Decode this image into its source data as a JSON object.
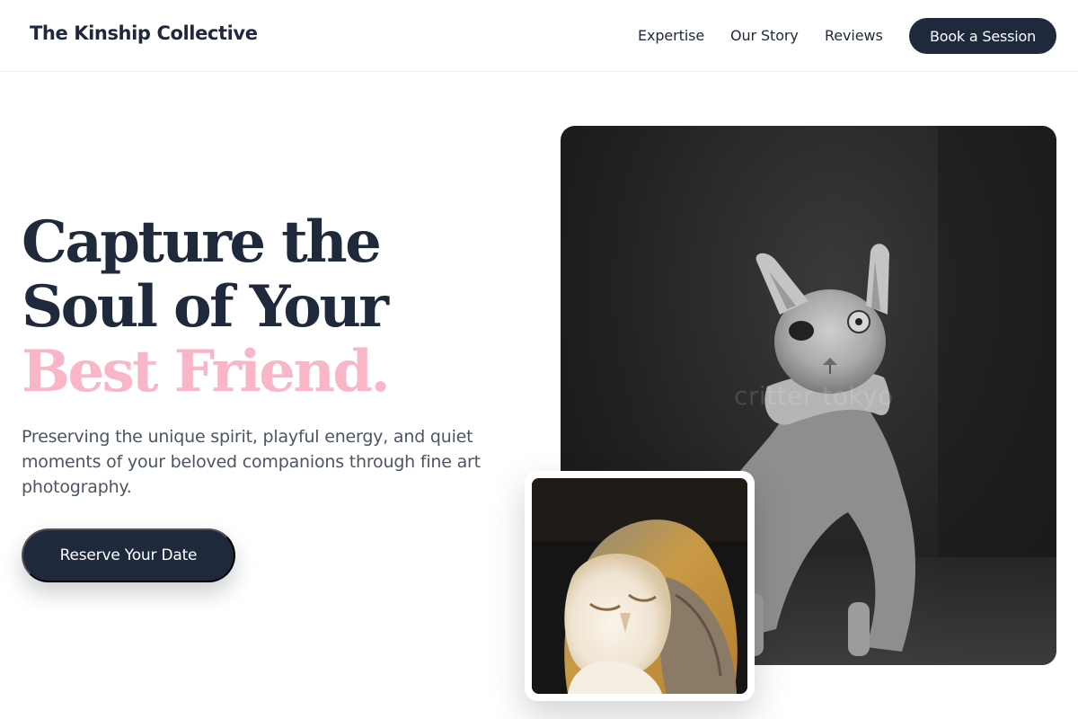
{
  "header": {
    "brand": "The Kinship Collective",
    "nav": {
      "expertise": "Expertise",
      "story": "Our Story",
      "reviews": "Reviews"
    },
    "cta": "Book a Session"
  },
  "hero": {
    "title_line1": "Capture the",
    "title_line2": "Soul of Your",
    "title_accent": "Best Friend.",
    "subtitle": "Preserving the unique spirit, playful energy, and quiet moments of your beloved companions through fine art photography.",
    "cta": "Reserve Your Date"
  },
  "images": {
    "main_watermark": "critter tokyo"
  },
  "colors": {
    "primary": "#1e293b",
    "accent_pink": "#f9b6c6",
    "body_text": "#4b5563"
  }
}
